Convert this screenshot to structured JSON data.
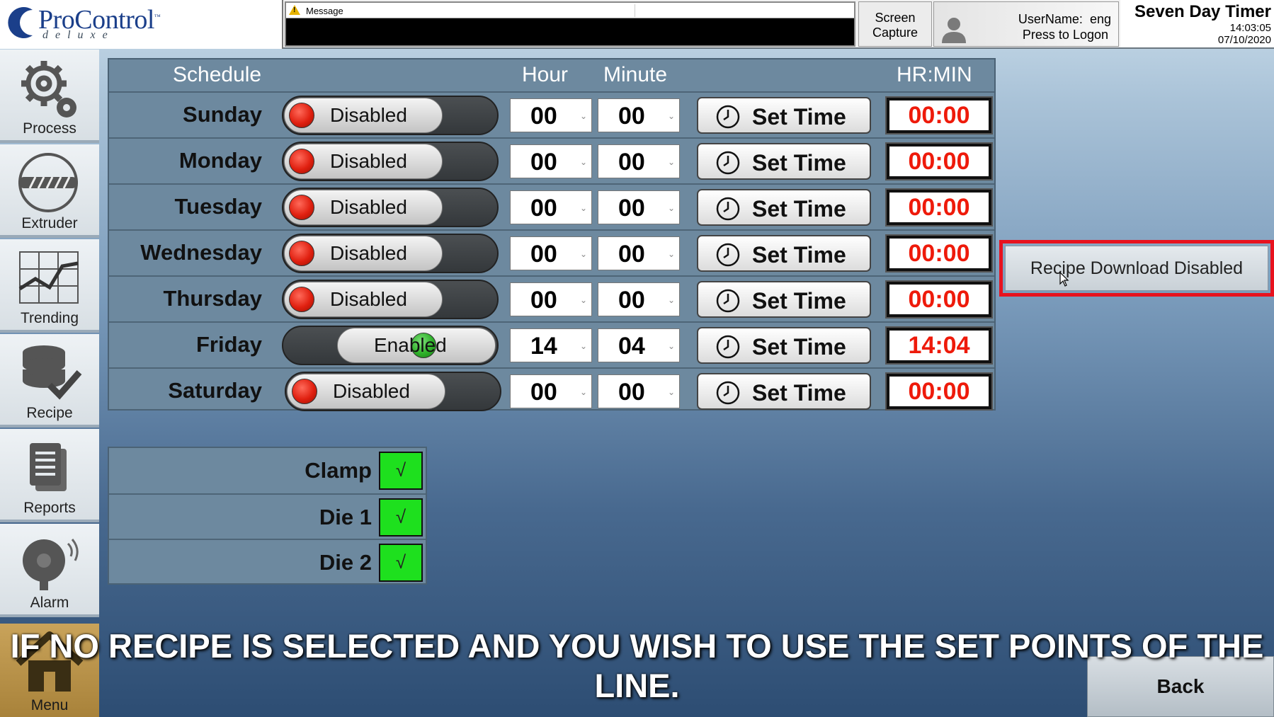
{
  "header": {
    "logo_main": "ProControl",
    "logo_tm": "™",
    "logo_sub": "deluxe",
    "message_label": "Message",
    "screen_capture_line1": "Screen",
    "screen_capture_line2": "Capture",
    "username_label": "UserName:",
    "username_value": "eng",
    "press_to_logon": "Press to Logon",
    "page_title": "Seven Day Timer",
    "time": "14:03:05",
    "date": "07/10/2020"
  },
  "sidebar": {
    "items": [
      {
        "label": "Process",
        "icon": "gears-icon"
      },
      {
        "label": "Extruder",
        "icon": "extruder-screw-icon"
      },
      {
        "label": "Trending",
        "icon": "trend-chart-icon"
      },
      {
        "label": "Recipe",
        "icon": "database-check-icon"
      },
      {
        "label": "Reports",
        "icon": "document-icon"
      },
      {
        "label": "Alarm",
        "icon": "alarm-bell-icon"
      },
      {
        "label": "Menu",
        "icon": "home-icon"
      }
    ]
  },
  "schedule": {
    "headers": {
      "schedule": "Schedule",
      "hour": "Hour",
      "minute": "Minute",
      "hrmin": "HR:MIN"
    },
    "set_time_label": "Set Time",
    "days": [
      {
        "day": "Sunday",
        "status": "Disabled",
        "enabled": false,
        "hour": "00",
        "minute": "00",
        "display": "00:00"
      },
      {
        "day": "Monday",
        "status": "Disabled",
        "enabled": false,
        "hour": "00",
        "minute": "00",
        "display": "00:00"
      },
      {
        "day": "Tuesday",
        "status": "Disabled",
        "enabled": false,
        "hour": "00",
        "minute": "00",
        "display": "00:00"
      },
      {
        "day": "Wednesday",
        "status": "Disabled",
        "enabled": false,
        "hour": "00",
        "minute": "00",
        "display": "00:00"
      },
      {
        "day": "Thursday",
        "status": "Disabled",
        "enabled": false,
        "hour": "00",
        "minute": "00",
        "display": "00:00"
      },
      {
        "day": "Friday",
        "status": "Enabled",
        "enabled": true,
        "hour": "14",
        "minute": "04",
        "display": "14:04"
      },
      {
        "day": "Saturday",
        "status": "Disabled",
        "enabled": false,
        "hour": "00",
        "minute": "00",
        "display": "00:00"
      }
    ]
  },
  "recipe_download": {
    "label": "Recipe Download Disabled",
    "highlight_color": "#e8121e"
  },
  "interlocks": [
    {
      "label": "Clamp",
      "status": "√"
    },
    {
      "label": "Die 1",
      "status": "√"
    },
    {
      "label": "Die 2",
      "status": "√"
    }
  ],
  "caption_line1": "IF NO RECIPE IS SELECTED AND YOU WISH TO USE THE SET POINTS OF THE",
  "caption_line2": "LINE.",
  "back_label": "Back",
  "colors": {
    "enabled_led": "#2fb12a",
    "disabled_led": "#e02010",
    "time_display_text": "#ee1a0a",
    "interlock_ok": "#1ee01e"
  }
}
